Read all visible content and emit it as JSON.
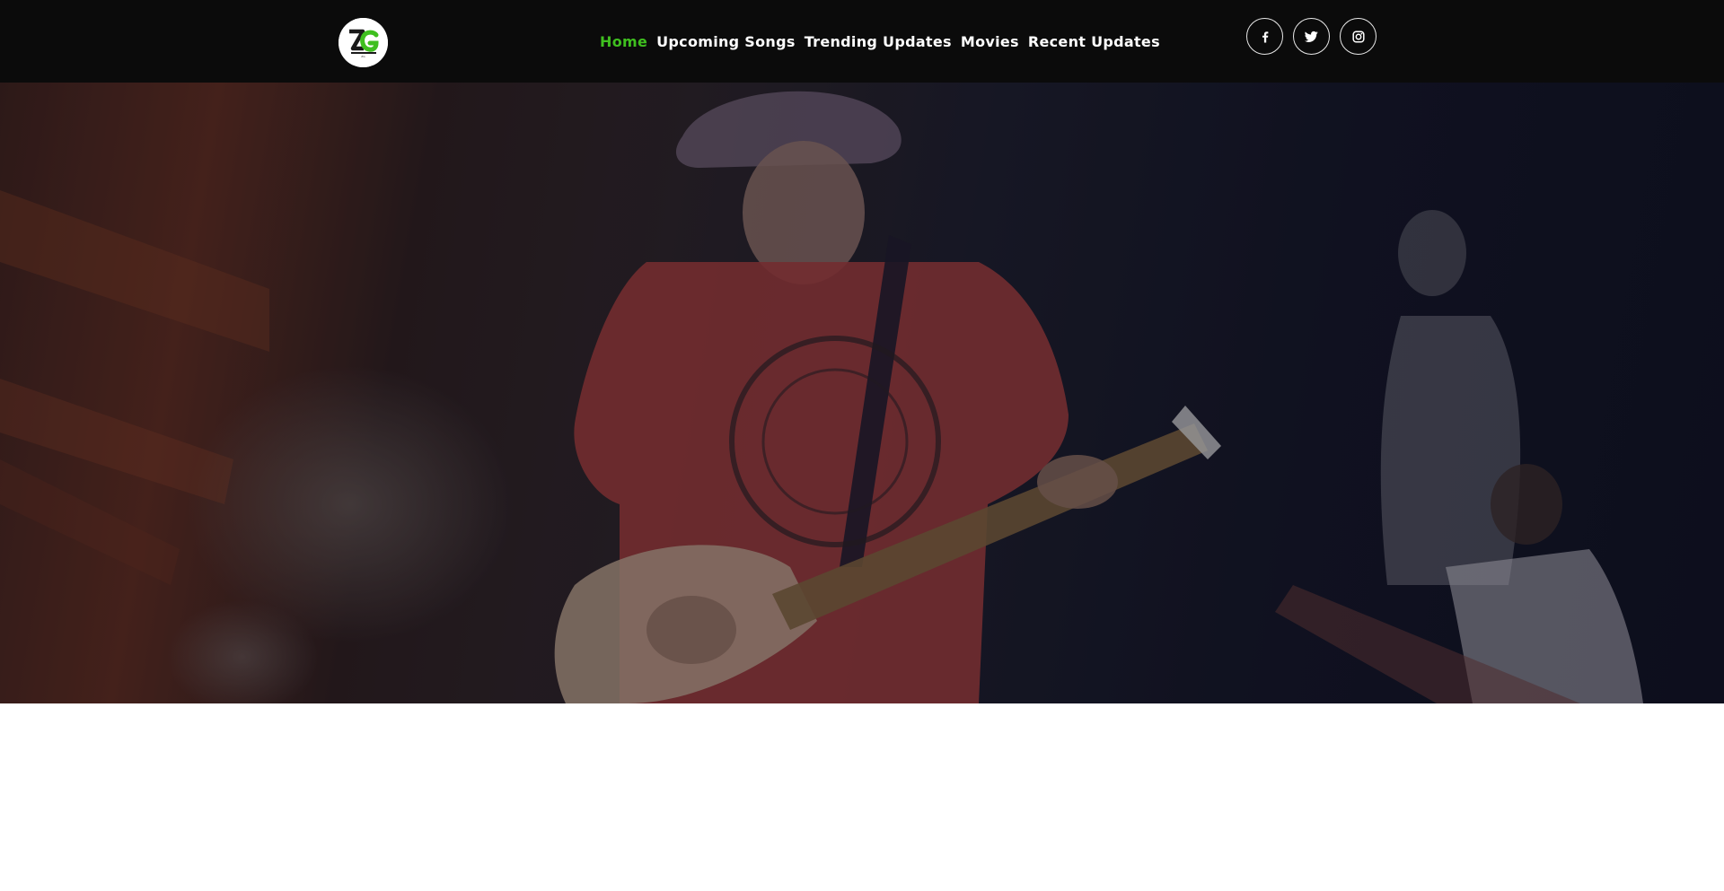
{
  "brand": {
    "logo_icon": "zg-logo",
    "logo_text": "ZG",
    "accent_color": "#3fbf1f"
  },
  "nav": {
    "items": [
      {
        "label": "Home",
        "active": true
      },
      {
        "label": "Upcoming Songs",
        "active": false
      },
      {
        "label": "Trending Updates",
        "active": false
      },
      {
        "label": "Movies",
        "active": false
      },
      {
        "label": "Recent Updates",
        "active": false
      }
    ]
  },
  "social": [
    {
      "icon": "facebook-icon",
      "glyph": "f"
    },
    {
      "icon": "twitter-icon"
    },
    {
      "icon": "instagram-icon"
    }
  ],
  "hero": {
    "image": "concert-guitarist-banner"
  }
}
